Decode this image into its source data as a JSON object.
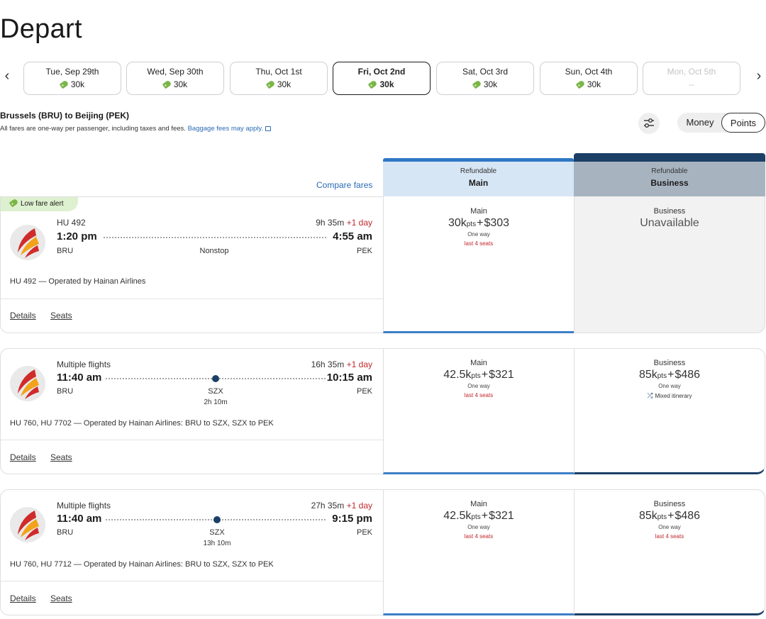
{
  "page_title": "Depart",
  "date_nav": {
    "prev_glyph": "‹",
    "next_glyph": "›"
  },
  "dates": [
    {
      "label": "Tue, Sep 29th",
      "price": "30k",
      "state": "normal"
    },
    {
      "label": "Wed, Sep 30th",
      "price": "30k",
      "state": "normal"
    },
    {
      "label": "Thu, Oct 1st",
      "price": "30k",
      "state": "normal"
    },
    {
      "label": "Fri, Oct 2nd",
      "price": "30k",
      "state": "selected"
    },
    {
      "label": "Sat, Oct 3rd",
      "price": "30k",
      "state": "normal"
    },
    {
      "label": "Sun, Oct 4th",
      "price": "30k",
      "state": "normal"
    },
    {
      "label": "Mon, Oct 5th",
      "price": "--",
      "state": "disabled"
    }
  ],
  "route": {
    "title": "Brussels (BRU) to Beijing (PEK)",
    "note": "All fares are one-way per passenger, including taxes and fees.",
    "baggage_link": "Baggage fees may apply."
  },
  "toggle": {
    "money": "Money",
    "points": "Points",
    "selected": "points"
  },
  "compare_fares": "Compare fares",
  "columns": {
    "main": {
      "sub": "Refundable",
      "label": "Main"
    },
    "business": {
      "sub": "Refundable",
      "label": "Business"
    }
  },
  "colors": {
    "main_accent": "#2f78c4",
    "business_accent": "#1c3f66",
    "alert_red": "#c0282d",
    "link_blue": "#2a6bb5",
    "low_fare_green": "#ddf0cf"
  },
  "flights": [
    {
      "badge": "Low fare alert",
      "flight_label": "HU 492",
      "duration": "9h 35m",
      "plus_day": "+1 day",
      "depart": "1:20 pm",
      "arrive": "4:55 am",
      "from": "BRU",
      "to": "PEK",
      "stop": "Nonstop",
      "layover": "",
      "operated": "HU 492 — Operated by Hainan Airlines",
      "details": "Details",
      "seats": "Seats",
      "main_fare": {
        "label": "Main",
        "points": "30k",
        "pts": "pts",
        "plus": "+",
        "cash": "$303",
        "oneway": "One way",
        "note": "last 4 seats"
      },
      "business_fare": {
        "label": "Business",
        "unavailable": "Unavailable"
      }
    },
    {
      "badge": "",
      "flight_label": "Multiple flights",
      "duration": "16h 35m",
      "plus_day": "+1 day",
      "depart": "11:40 am",
      "arrive": "10:15 am",
      "from": "BRU",
      "to": "PEK",
      "stop": "SZX",
      "layover": "2h 10m",
      "operated": "HU 760, HU 7702 — Operated by Hainan Airlines: BRU to SZX, SZX to PEK",
      "details": "Details",
      "seats": "Seats",
      "main_fare": {
        "label": "Main",
        "points": "42.5k",
        "pts": "pts",
        "plus": "+",
        "cash": "$321",
        "oneway": "One way",
        "note": "last 4 seats"
      },
      "business_fare": {
        "label": "Business",
        "points": "85k",
        "pts": "pts",
        "plus": "+",
        "cash": "$486",
        "oneway": "One way",
        "mixed": "Mixed itinerary"
      }
    },
    {
      "badge": "",
      "flight_label": "Multiple flights",
      "duration": "27h 35m",
      "plus_day": "+1 day",
      "depart": "11:40 am",
      "arrive": "9:15 pm",
      "from": "BRU",
      "to": "PEK",
      "stop": "SZX",
      "layover": "13h 10m",
      "operated": "HU 760, HU 7712 — Operated by Hainan Airlines: BRU to SZX, SZX to PEK",
      "details": "Details",
      "seats": "Seats",
      "main_fare": {
        "label": "Main",
        "points": "42.5k",
        "pts": "pts",
        "plus": "+",
        "cash": "$321",
        "oneway": "One way",
        "note": "last 4 seats"
      },
      "business_fare": {
        "label": "Business",
        "points": "85k",
        "pts": "pts",
        "plus": "+",
        "cash": "$486",
        "oneway": "One way",
        "note": "last 4 seats"
      }
    }
  ]
}
